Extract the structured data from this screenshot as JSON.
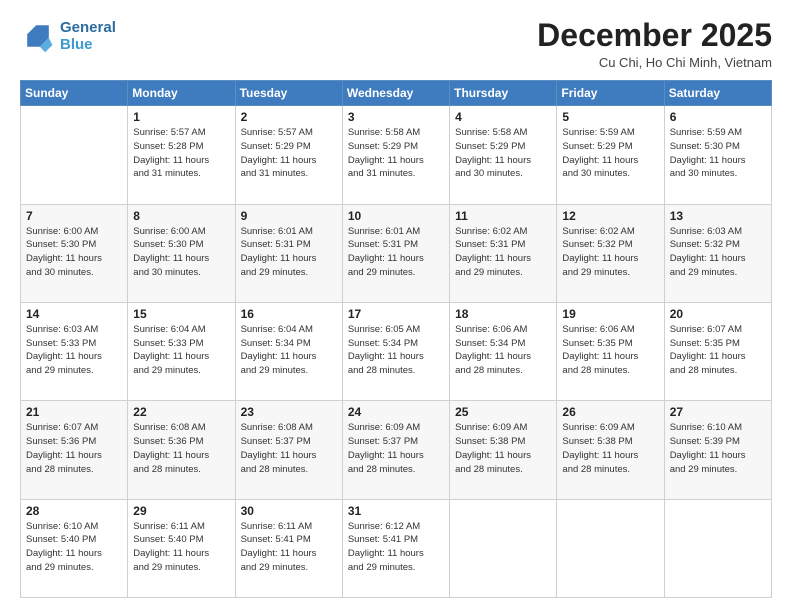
{
  "header": {
    "logo_line1": "General",
    "logo_line2": "Blue",
    "title": "December 2025",
    "location": "Cu Chi, Ho Chi Minh, Vietnam"
  },
  "weekdays": [
    "Sunday",
    "Monday",
    "Tuesday",
    "Wednesday",
    "Thursday",
    "Friday",
    "Saturday"
  ],
  "weeks": [
    [
      {
        "day": "",
        "info": ""
      },
      {
        "day": "1",
        "info": "Sunrise: 5:57 AM\nSunset: 5:28 PM\nDaylight: 11 hours\nand 31 minutes."
      },
      {
        "day": "2",
        "info": "Sunrise: 5:57 AM\nSunset: 5:29 PM\nDaylight: 11 hours\nand 31 minutes."
      },
      {
        "day": "3",
        "info": "Sunrise: 5:58 AM\nSunset: 5:29 PM\nDaylight: 11 hours\nand 31 minutes."
      },
      {
        "day": "4",
        "info": "Sunrise: 5:58 AM\nSunset: 5:29 PM\nDaylight: 11 hours\nand 30 minutes."
      },
      {
        "day": "5",
        "info": "Sunrise: 5:59 AM\nSunset: 5:29 PM\nDaylight: 11 hours\nand 30 minutes."
      },
      {
        "day": "6",
        "info": "Sunrise: 5:59 AM\nSunset: 5:30 PM\nDaylight: 11 hours\nand 30 minutes."
      }
    ],
    [
      {
        "day": "7",
        "info": "Sunrise: 6:00 AM\nSunset: 5:30 PM\nDaylight: 11 hours\nand 30 minutes."
      },
      {
        "day": "8",
        "info": "Sunrise: 6:00 AM\nSunset: 5:30 PM\nDaylight: 11 hours\nand 30 minutes."
      },
      {
        "day": "9",
        "info": "Sunrise: 6:01 AM\nSunset: 5:31 PM\nDaylight: 11 hours\nand 29 minutes."
      },
      {
        "day": "10",
        "info": "Sunrise: 6:01 AM\nSunset: 5:31 PM\nDaylight: 11 hours\nand 29 minutes."
      },
      {
        "day": "11",
        "info": "Sunrise: 6:02 AM\nSunset: 5:31 PM\nDaylight: 11 hours\nand 29 minutes."
      },
      {
        "day": "12",
        "info": "Sunrise: 6:02 AM\nSunset: 5:32 PM\nDaylight: 11 hours\nand 29 minutes."
      },
      {
        "day": "13",
        "info": "Sunrise: 6:03 AM\nSunset: 5:32 PM\nDaylight: 11 hours\nand 29 minutes."
      }
    ],
    [
      {
        "day": "14",
        "info": "Sunrise: 6:03 AM\nSunset: 5:33 PM\nDaylight: 11 hours\nand 29 minutes."
      },
      {
        "day": "15",
        "info": "Sunrise: 6:04 AM\nSunset: 5:33 PM\nDaylight: 11 hours\nand 29 minutes."
      },
      {
        "day": "16",
        "info": "Sunrise: 6:04 AM\nSunset: 5:34 PM\nDaylight: 11 hours\nand 29 minutes."
      },
      {
        "day": "17",
        "info": "Sunrise: 6:05 AM\nSunset: 5:34 PM\nDaylight: 11 hours\nand 28 minutes."
      },
      {
        "day": "18",
        "info": "Sunrise: 6:06 AM\nSunset: 5:34 PM\nDaylight: 11 hours\nand 28 minutes."
      },
      {
        "day": "19",
        "info": "Sunrise: 6:06 AM\nSunset: 5:35 PM\nDaylight: 11 hours\nand 28 minutes."
      },
      {
        "day": "20",
        "info": "Sunrise: 6:07 AM\nSunset: 5:35 PM\nDaylight: 11 hours\nand 28 minutes."
      }
    ],
    [
      {
        "day": "21",
        "info": "Sunrise: 6:07 AM\nSunset: 5:36 PM\nDaylight: 11 hours\nand 28 minutes."
      },
      {
        "day": "22",
        "info": "Sunrise: 6:08 AM\nSunset: 5:36 PM\nDaylight: 11 hours\nand 28 minutes."
      },
      {
        "day": "23",
        "info": "Sunrise: 6:08 AM\nSunset: 5:37 PM\nDaylight: 11 hours\nand 28 minutes."
      },
      {
        "day": "24",
        "info": "Sunrise: 6:09 AM\nSunset: 5:37 PM\nDaylight: 11 hours\nand 28 minutes."
      },
      {
        "day": "25",
        "info": "Sunrise: 6:09 AM\nSunset: 5:38 PM\nDaylight: 11 hours\nand 28 minutes."
      },
      {
        "day": "26",
        "info": "Sunrise: 6:09 AM\nSunset: 5:38 PM\nDaylight: 11 hours\nand 28 minutes."
      },
      {
        "day": "27",
        "info": "Sunrise: 6:10 AM\nSunset: 5:39 PM\nDaylight: 11 hours\nand 29 minutes."
      }
    ],
    [
      {
        "day": "28",
        "info": "Sunrise: 6:10 AM\nSunset: 5:40 PM\nDaylight: 11 hours\nand 29 minutes."
      },
      {
        "day": "29",
        "info": "Sunrise: 6:11 AM\nSunset: 5:40 PM\nDaylight: 11 hours\nand 29 minutes."
      },
      {
        "day": "30",
        "info": "Sunrise: 6:11 AM\nSunset: 5:41 PM\nDaylight: 11 hours\nand 29 minutes."
      },
      {
        "day": "31",
        "info": "Sunrise: 6:12 AM\nSunset: 5:41 PM\nDaylight: 11 hours\nand 29 minutes."
      },
      {
        "day": "",
        "info": ""
      },
      {
        "day": "",
        "info": ""
      },
      {
        "day": "",
        "info": ""
      }
    ]
  ]
}
